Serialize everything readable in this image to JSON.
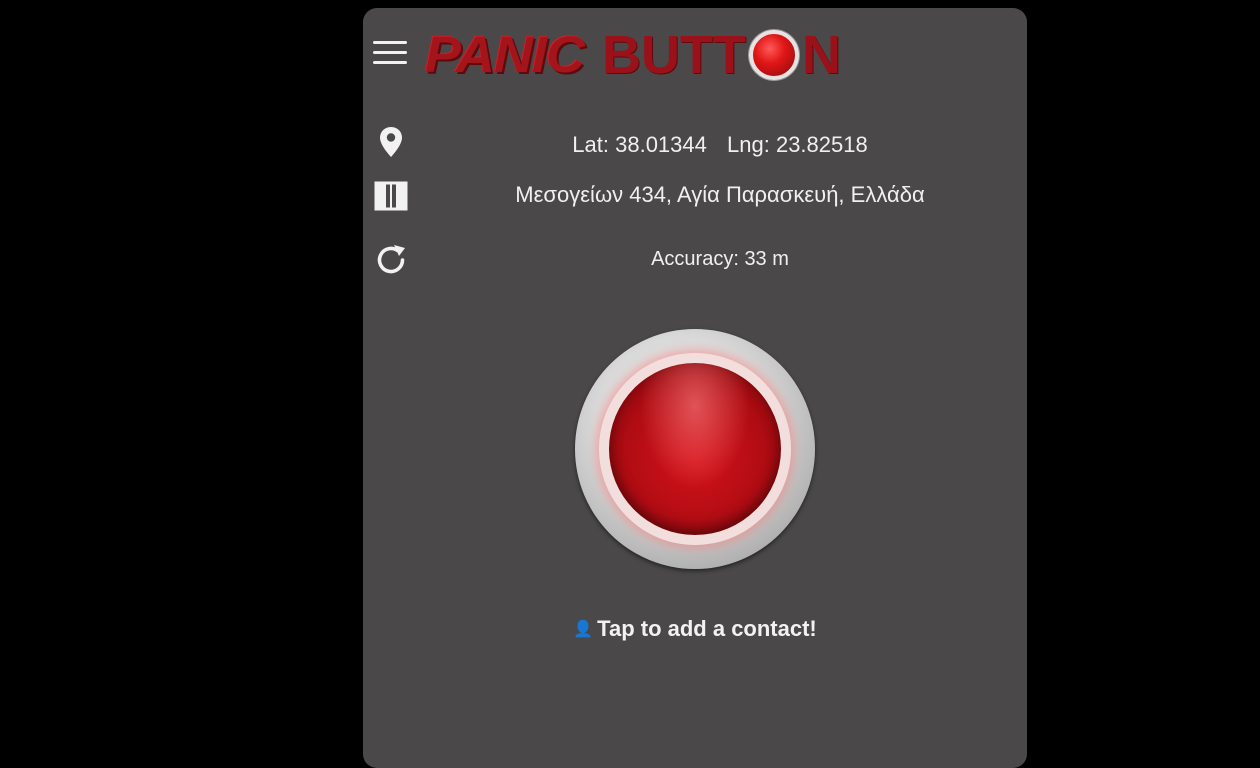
{
  "header": {
    "logo_part1": "PANIC",
    "logo_part2_pre": "BUTT",
    "logo_part2_post": "N",
    "menu_icon": "hamburger-icon"
  },
  "location": {
    "lat_label": "Lat:",
    "lat_value": "38.01344",
    "lng_label": "Lng:",
    "lng_value": "23.82518",
    "address": "Μεσογείων 434, Αγία Παρασκευή, Ελλάδα",
    "accuracy": "Accuracy: 33 m",
    "icons": [
      "map-marker-icon",
      "map-icon",
      "refresh-icon"
    ]
  },
  "contact": {
    "label": "Tap to add a contact!",
    "icon": "user-icon"
  },
  "colors": {
    "background": "#000000",
    "panel": "#4a4849",
    "brand_red": "#a3141b",
    "text": "#f0f0f0"
  }
}
